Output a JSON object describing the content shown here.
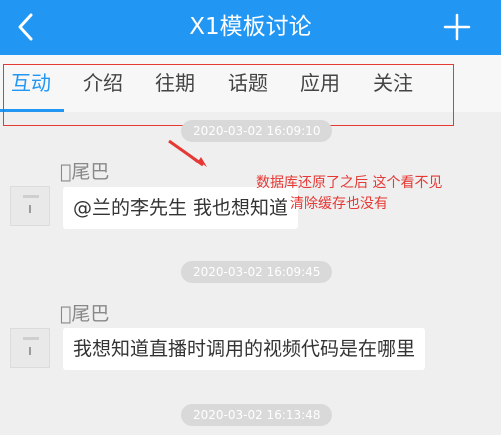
{
  "header": {
    "title": "X1模板讨论",
    "back_icon": "chevron-left-icon",
    "add_icon": "plus-icon",
    "background": "#2196f3"
  },
  "tabs": [
    {
      "label": "互动",
      "active": true
    },
    {
      "label": "介绍"
    },
    {
      "label": "往期"
    },
    {
      "label": "话题"
    },
    {
      "label": "应用"
    },
    {
      "label": "关注"
    }
  ],
  "messages": [
    {
      "timestamp": "2020-03-02 16:09:10",
      "sender": "\u0000尾巴",
      "text": "@兰的李先生 我也想知道"
    },
    {
      "timestamp": "2020-03-02 16:09:45",
      "sender": "\u0000尾巴",
      "text": "我想知道直播时调用的视频代码是在哪里"
    },
    {
      "timestamp": "2020-03-02 16:13:48"
    }
  ],
  "annotation": {
    "line1": "数据库还原了之后 这个看不见",
    "line2": "清除缓存也没有",
    "color": "#e53935"
  }
}
